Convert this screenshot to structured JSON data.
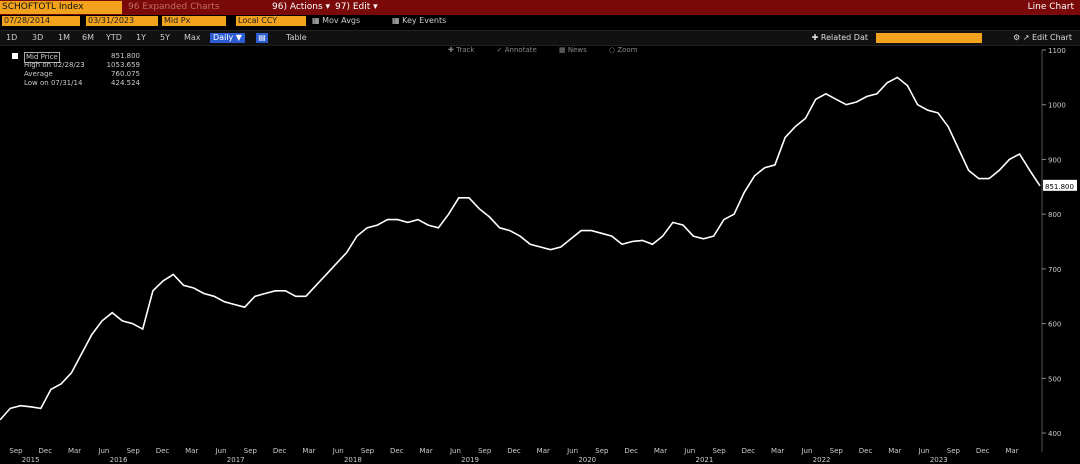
{
  "header": {
    "ticker": "SCHOFTOTL Index",
    "expanded": "96 Expanded Charts",
    "actions": "96) Actions ▾",
    "edit": "97) Edit ▾",
    "chart_type": "Line Chart"
  },
  "toolbar": {
    "start_date": "07/28/2014",
    "end_date": "03/31/2023",
    "field": "Mid Px",
    "currency": "Local CCY",
    "mov_avgs": "Mov Avgs",
    "key_events": "Key Events"
  },
  "ranges": {
    "items": [
      "1D",
      "3D",
      "1M",
      "6M",
      "YTD",
      "1Y",
      "5Y",
      "Max"
    ],
    "active": "Daily",
    "table": "Table",
    "related": "Related Dat",
    "edit_chart": "Edit Chart"
  },
  "tools": [
    "Track",
    "Annotate",
    "News",
    "Zoom"
  ],
  "legend": [
    {
      "label": "Mid Price",
      "value": "851.800"
    },
    {
      "label": "High on 02/28/23",
      "value": "1053.659"
    },
    {
      "label": "Average",
      "value": "760.075"
    },
    {
      "label": "Low on 07/31/14",
      "value": "424.524"
    }
  ],
  "colors": {
    "accent": "#f2a21c",
    "header_bg": "#7a0a0a",
    "line": "#ffffff",
    "active": "#2d5bd1"
  },
  "chart_data": {
    "type": "line",
    "series": [
      {
        "name": "Mid Price",
        "values": [
          424,
          445,
          450,
          448,
          445,
          480,
          490,
          510,
          545,
          580,
          605,
          620,
          605,
          600,
          590,
          660,
          678,
          690,
          670,
          665,
          655,
          650,
          640,
          635,
          630,
          650,
          655,
          660,
          660,
          650,
          650,
          670,
          690,
          710,
          730,
          760,
          775,
          780,
          790,
          790,
          785,
          790,
          780,
          775,
          800,
          830,
          830,
          810,
          795,
          775,
          770,
          760,
          745,
          740,
          735,
          740,
          755,
          770,
          770,
          765,
          760,
          745,
          750,
          752,
          745,
          760,
          785,
          780,
          760,
          755,
          760,
          790,
          800,
          840,
          870,
          885,
          890,
          940,
          960,
          975,
          1010,
          1020,
          1010,
          1000,
          1005,
          1015,
          1020,
          1040,
          1050,
          1035,
          1000,
          990,
          985,
          960,
          920,
          880,
          865,
          865,
          880,
          900,
          910,
          880,
          851.8
        ]
      }
    ],
    "ylim": [
      380,
      1100
    ],
    "yticks": [
      400,
      500,
      600,
      700,
      800,
      900,
      1000,
      1100
    ],
    "last_label": "851.800",
    "x_months": [
      "Sep",
      "Dec",
      "Mar",
      "Jun",
      "Sep",
      "Dec",
      "Mar",
      "Jun",
      "Sep",
      "Dec",
      "Mar",
      "Jun",
      "Sep",
      "Dec",
      "Mar",
      "Jun",
      "Sep",
      "Dec",
      "Mar",
      "Jun",
      "Sep",
      "Dec",
      "Mar",
      "Jun",
      "Sep",
      "Dec",
      "Mar",
      "Jun",
      "Sep",
      "Dec",
      "Mar",
      "Jun",
      "Sep",
      "Dec",
      "Mar"
    ],
    "x_years": [
      {
        "label": "2015",
        "index": 0
      },
      {
        "label": "2016",
        "index": 3
      },
      {
        "label": "2017",
        "index": 7
      },
      {
        "label": "2018",
        "index": 11
      },
      {
        "label": "2019",
        "index": 15
      },
      {
        "label": "2020",
        "index": 19
      },
      {
        "label": "2021",
        "index": 23
      },
      {
        "label": "2022",
        "index": 27
      },
      {
        "label": "2023",
        "index": 31
      }
    ]
  }
}
